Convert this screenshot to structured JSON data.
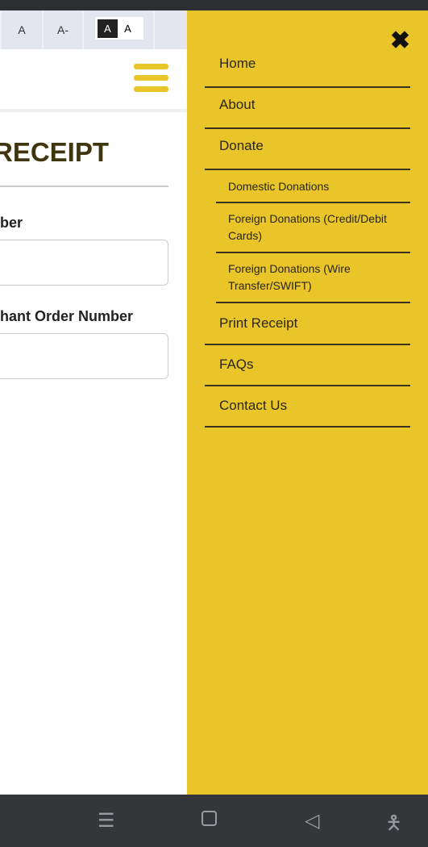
{
  "font_controls": {
    "normal": "A",
    "decrease": "A-",
    "contrast_dark": "A",
    "contrast_light": "A"
  },
  "page": {
    "title": "RECEIPT",
    "field1_label": "ber",
    "field2_label": "hant Order Number",
    "field1_value": "",
    "field2_value": ""
  },
  "menu": {
    "items": [
      {
        "label": "Home"
      },
      {
        "label": "About"
      },
      {
        "label": "Donate"
      },
      {
        "label": "Domestic Donations"
      },
      {
        "label": "Foreign Donations (Credit/Debit Cards)"
      },
      {
        "label": "Foreign Donations (Wire Transfer/SWIFT)"
      },
      {
        "label": "Print Receipt"
      },
      {
        "label": "FAQs"
      },
      {
        "label": "Contact Us"
      }
    ]
  },
  "colors": {
    "accent": "#e9c52a",
    "title": "#3f3610"
  }
}
